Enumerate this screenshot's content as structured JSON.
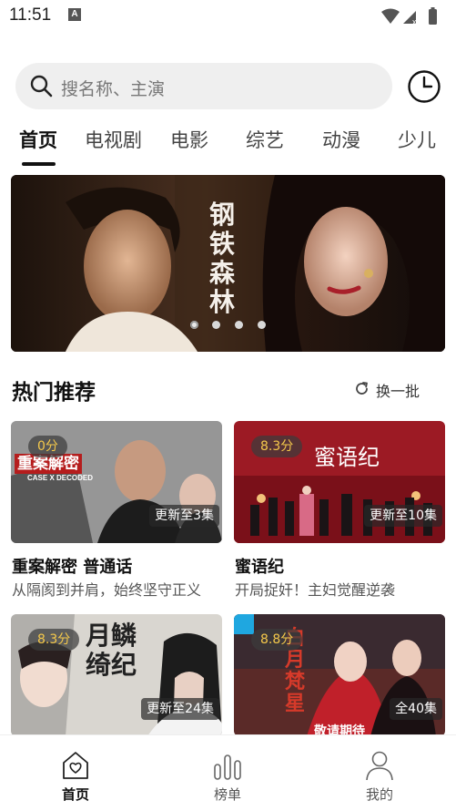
{
  "status_bar": {
    "time": "11:51",
    "notification_badge": "A"
  },
  "search": {
    "placeholder": "搜名称、主演"
  },
  "tabs": [
    {
      "label": "首页",
      "active": true
    },
    {
      "label": "电视剧",
      "active": false
    },
    {
      "label": "电影",
      "active": false
    },
    {
      "label": "综艺",
      "active": false
    },
    {
      "label": "动漫",
      "active": false
    },
    {
      "label": "少儿",
      "active": false
    }
  ],
  "banner": {
    "title_art": "钢铁森林",
    "slide_count": 4,
    "active_slide": 1
  },
  "hot": {
    "title": "热门推荐",
    "refresh_label": "换一批",
    "items": [
      {
        "score": "0分",
        "update": "更新至3集",
        "title": "重案解密 普通话",
        "desc": "从隔阂到并肩，始终坚守正义",
        "poster_text": "重案解密",
        "poster_subtext": "CASE X DECODED"
      },
      {
        "score": "8.3分",
        "update": "更新至10集",
        "title": "蜜语纪",
        "desc": "开局捉奸！主妇觉醒逆袭",
        "poster_text": "蜜语纪"
      },
      {
        "score": "8.3分",
        "update": "更新至24集",
        "title": "",
        "desc": "",
        "poster_text": "月鳞绮纪"
      },
      {
        "score": "8.8分",
        "update": "全40集",
        "title": "",
        "desc": "",
        "poster_text": "白月梵星",
        "poster_subtext": "敬请期待"
      }
    ]
  },
  "bottom_nav": [
    {
      "label": "首页",
      "icon": "home-heart-icon",
      "active": true
    },
    {
      "label": "榜单",
      "icon": "chart-bars-icon",
      "active": false
    },
    {
      "label": "我的",
      "icon": "user-icon",
      "active": false
    }
  ],
  "colors": {
    "accent": "#111111",
    "score_text": "#f5c94b",
    "search_bg": "#efefef"
  }
}
